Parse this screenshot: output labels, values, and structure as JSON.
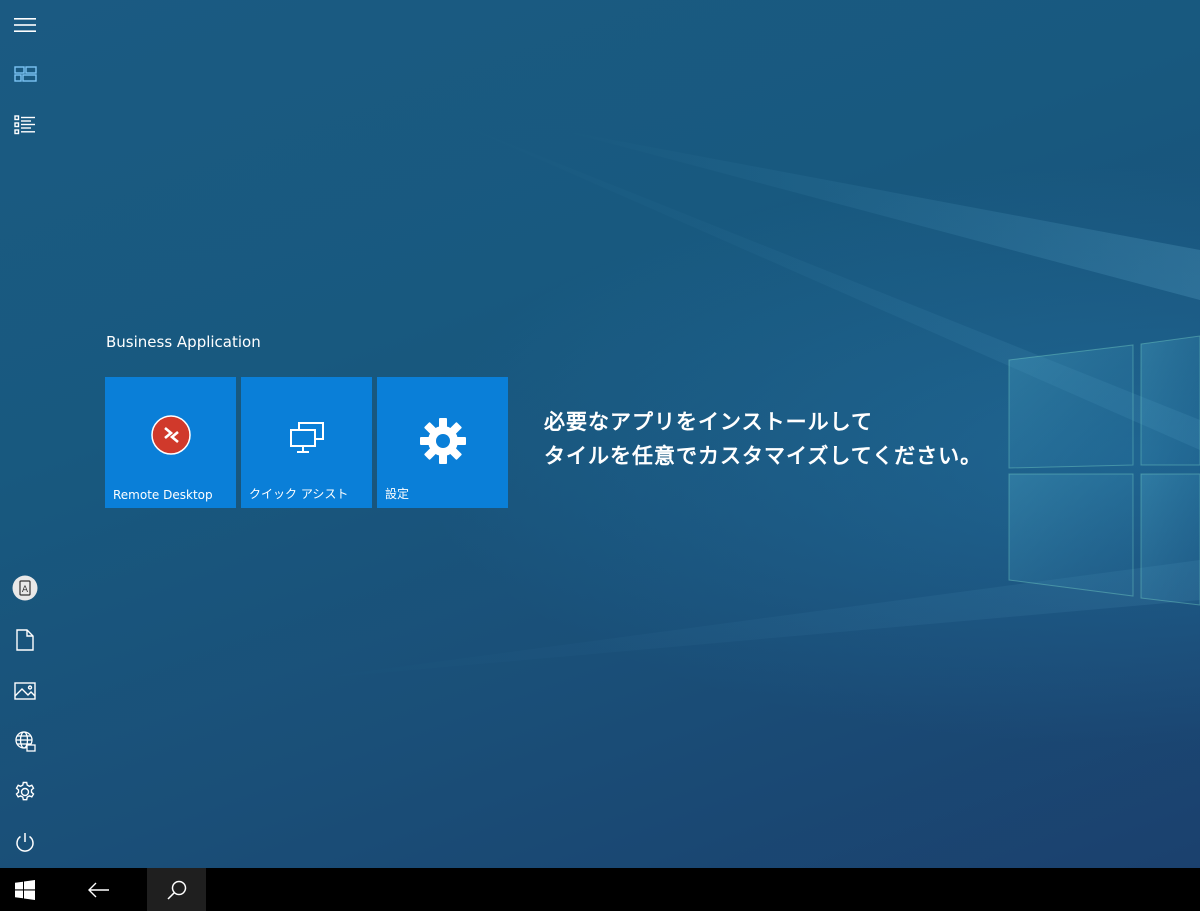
{
  "group": {
    "title": "Business Application"
  },
  "tiles": [
    {
      "label": "Remote Desktop",
      "icon": "remote-desktop-icon"
    },
    {
      "label": "クイック アシスト",
      "icon": "quick-assist-icon"
    },
    {
      "label": "設定",
      "icon": "settings-gear-icon"
    }
  ],
  "message": {
    "line1": "必要なアプリをインストールして",
    "line2": "タイルを任意でカスタマイズしてください。"
  },
  "rail_icons": [
    "hamburger-menu-icon",
    "tiles-view-icon",
    "all-apps-list-icon",
    "user-account-icon",
    "documents-icon",
    "pictures-icon",
    "network-icon",
    "settings-icon",
    "power-icon"
  ],
  "taskbar_icons": [
    "windows-start-icon",
    "back-arrow-icon",
    "search-icon"
  ],
  "colors": {
    "tile": "#0a7fd8",
    "taskbar": "#000000",
    "remote_desktop_badge": "#d0392b",
    "search_button_bg": "#1f1f1f"
  }
}
